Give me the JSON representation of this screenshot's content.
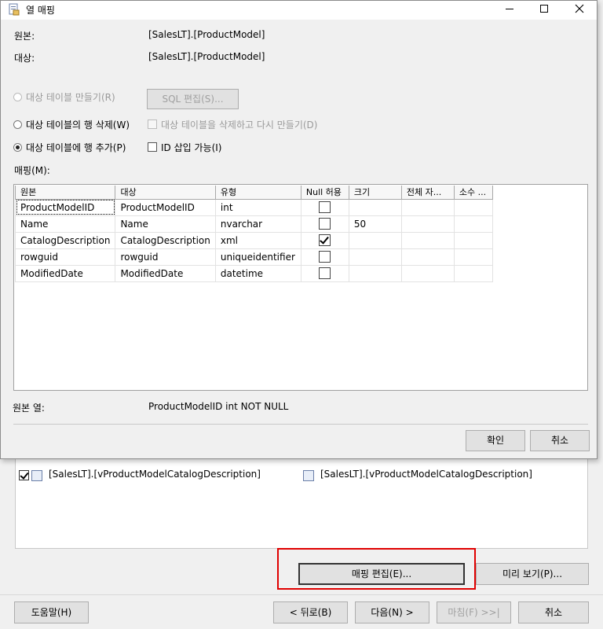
{
  "background": {
    "list_row": {
      "source": "[SalesLT].[vProductModelCatalogDescription]",
      "destination": "[SalesLT].[vProductModelCatalogDescription]"
    },
    "buttons": {
      "edit_mappings": "매핑 편집(E)...",
      "preview": "미리 보기(P)...",
      "help": "도움말(H)",
      "back": "< 뒤로(B)",
      "next": "다음(N) >",
      "finish": "마침(F) >>|",
      "cancel": "취소"
    }
  },
  "dialog": {
    "title": "열 매핑",
    "source_label": "원본:",
    "source_value": "[SalesLT].[ProductModel]",
    "destination_label": "대상:",
    "destination_value": "[SalesLT].[ProductModel]",
    "options": {
      "create_table": "대상 테이블 만들기(R)",
      "edit_sql": "SQL 편집(S)...",
      "delete_rows": "대상 테이블의 행 삭제(W)",
      "drop_recreate": "대상 테이블을 삭제하고 다시 만들기(D)",
      "append_rows": "대상 테이블에 행 추가(P)",
      "identity_insert": "ID 삽입 가능(I)"
    },
    "mappings_label": "매핑(M):",
    "columns": [
      "원본",
      "대상",
      "유형",
      "Null 허용",
      "크기",
      "전체 자...",
      "소수 ..."
    ],
    "rows": [
      {
        "source": "ProductModelID",
        "dest": "ProductModelID",
        "type": "int",
        "nullable": false,
        "size": ""
      },
      {
        "source": "Name",
        "dest": "Name",
        "type": "nvarchar",
        "nullable": false,
        "size": "50"
      },
      {
        "source": "CatalogDescription",
        "dest": "CatalogDescription",
        "type": "xml",
        "nullable": true,
        "size": ""
      },
      {
        "source": "rowguid",
        "dest": "rowguid",
        "type": "uniqueidentifier",
        "nullable": false,
        "size": ""
      },
      {
        "source": "ModifiedDate",
        "dest": "ModifiedDate",
        "type": "datetime",
        "nullable": false,
        "size": ""
      }
    ],
    "source_column_label": "원본 열:",
    "source_column_value": "ProductModelID int NOT NULL",
    "ok": "확인",
    "cancel": "취소"
  }
}
